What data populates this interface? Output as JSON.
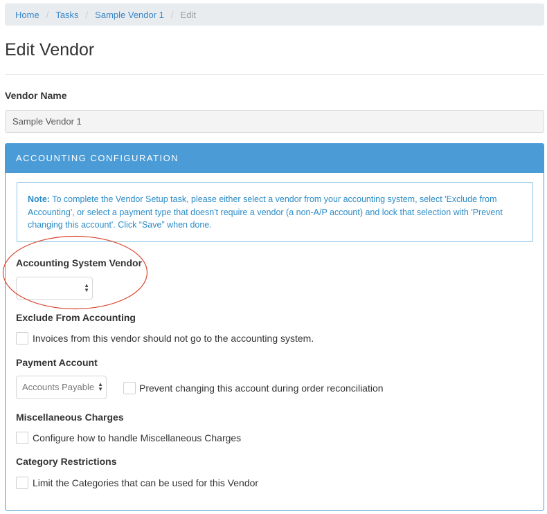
{
  "breadcrumb": {
    "items": [
      "Home",
      "Tasks",
      "Sample Vendor 1"
    ],
    "active": "Edit"
  },
  "page_title": "Edit Vendor",
  "vendor_name": {
    "label": "Vendor Name",
    "value": "Sample Vendor 1"
  },
  "accounting": {
    "heading": "ACCOUNTING CONFIGURATION",
    "note_label": "Note:",
    "note_text": " To complete the Vendor Setup task, please either select a vendor from your accounting system, select 'Exclude from Accounting', or select a payment type that doesn't require a vendor (a non-A/P account) and lock that selection with 'Prevent changing this account'. Click “Save” when done.",
    "system_vendor_label": "Accounting System Vendor",
    "system_vendor_value": "",
    "exclude_label": "Exclude From Accounting",
    "exclude_text": "Invoices from this vendor should not go to the accounting system.",
    "exclude_checked": false,
    "payment_label": "Payment Account",
    "payment_value": "Accounts Payable",
    "prevent_text": "Prevent changing this account during order reconciliation",
    "prevent_checked": false,
    "misc_label": "Miscellaneous Charges",
    "misc_text": "Configure how to handle Miscellaneous Charges",
    "misc_checked": false,
    "category_label": "Category Restrictions",
    "category_text": "Limit the Categories that can be used for this Vendor",
    "category_checked": false
  },
  "colors": {
    "accent": "#4a9bd6",
    "link": "#3a87c8",
    "annotation": "#d9432e"
  },
  "icons": {
    "select_arrows": "updown-arrows-icon"
  }
}
